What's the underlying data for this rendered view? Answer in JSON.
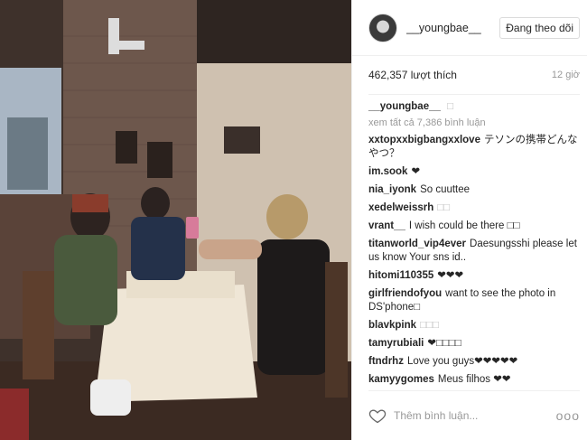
{
  "post": {
    "username": "__youngbae__",
    "follow_label": "Đang theo dõi",
    "likes": "462,357 lượt thích",
    "time": "12 giờ",
    "caption_user": "__youngbae__",
    "caption_text": "□",
    "view_all": "xem tất cả 7,386 bình luận"
  },
  "comments": [
    {
      "user": "xxtopxxbigbangxxlove",
      "text": "テソンの携帯どんなやつ？"
    },
    {
      "user": "im.sook",
      "text": "❤"
    },
    {
      "user": "nia_iyonk",
      "text": "So cuuttee"
    },
    {
      "user": "xedelweissrh",
      "text": "□□"
    },
    {
      "user": "vrant__",
      "text": "I wish could be there □□"
    },
    {
      "user": "titanworld_vip4ever",
      "text": "Daesungsshi please let us know Your sns id.."
    },
    {
      "user": "hitomi110355",
      "text": "❤❤❤"
    },
    {
      "user": "girlfriendofyou",
      "text": "want to see the photo in DS'phone□"
    },
    {
      "user": "blavkpink",
      "text": "□□□"
    },
    {
      "user": "tamyrubiali",
      "text": "❤□□□□"
    },
    {
      "user": "ftndrhz",
      "text": "Love you guys❤❤❤❤❤"
    },
    {
      "user": "kamyygomes",
      "text": "Meus filhos ❤❤"
    }
  ],
  "footer": {
    "placeholder": "Thêm bình luận...",
    "more": "ooo"
  }
}
